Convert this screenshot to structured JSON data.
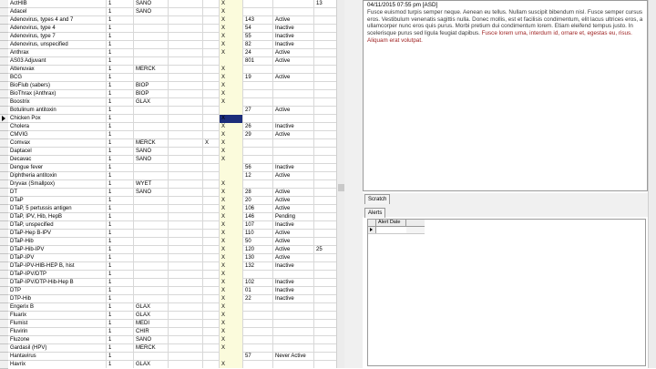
{
  "grid": {
    "rows": [
      {
        "name": "ActHIB",
        "num": "1",
        "a": "SANO",
        "b": "",
        "c": "",
        "x": "X",
        "d": "",
        "status": "",
        "e": "13"
      },
      {
        "name": "Adacel",
        "num": "1",
        "a": "SANO",
        "b": "",
        "c": "",
        "x": "X",
        "d": "",
        "status": "",
        "e": ""
      },
      {
        "name": "Adenovirus, types 4 and 7",
        "num": "1",
        "a": "",
        "b": "",
        "c": "",
        "x": "X",
        "d": "143",
        "status": "Active",
        "e": ""
      },
      {
        "name": "Adenovirus, type 4",
        "num": "1",
        "a": "",
        "b": "",
        "c": "",
        "x": "X",
        "d": "54",
        "status": "Inactive",
        "e": ""
      },
      {
        "name": "Adenovirus, type 7",
        "num": "1",
        "a": "",
        "b": "",
        "c": "",
        "x": "X",
        "d": "55",
        "status": "Inactive",
        "e": ""
      },
      {
        "name": "Adenovirus, unspecified",
        "num": "1",
        "a": "",
        "b": "",
        "c": "",
        "x": "X",
        "d": "82",
        "status": "Inactive",
        "e": ""
      },
      {
        "name": "Anthrax",
        "num": "1",
        "a": "",
        "b": "",
        "c": "",
        "x": "X",
        "d": "24",
        "status": "Active",
        "e": ""
      },
      {
        "name": "AS03 Adjuvant",
        "num": "1",
        "a": "",
        "b": "",
        "c": "",
        "x": "",
        "d": "801",
        "status": "Active",
        "e": ""
      },
      {
        "name": "Attenuvax",
        "num": "1",
        "a": "MERCK",
        "b": "",
        "c": "",
        "x": "X",
        "d": "",
        "status": "",
        "e": ""
      },
      {
        "name": "BCG",
        "num": "1",
        "a": "",
        "b": "",
        "c": "",
        "x": "X",
        "d": "19",
        "status": "Active",
        "e": ""
      },
      {
        "name": "BioFlub (sabers)",
        "num": "1",
        "a": "BIOP",
        "b": "",
        "c": "",
        "x": "X",
        "d": "",
        "status": "",
        "e": ""
      },
      {
        "name": "BioThrax (Anthrax)",
        "num": "1",
        "a": "BIOP",
        "b": "",
        "c": "",
        "x": "X",
        "d": "",
        "status": "",
        "e": ""
      },
      {
        "name": "Boostrix",
        "num": "1",
        "a": "GLAX",
        "b": "",
        "c": "",
        "x": "X",
        "d": "",
        "status": "",
        "e": ""
      },
      {
        "name": "Botulinum antitoxin",
        "num": "1",
        "a": "",
        "b": "",
        "c": "",
        "x": "",
        "d": "27",
        "status": "Active",
        "e": ""
      },
      {
        "name": "Chicken Pox",
        "num": "1",
        "a": "",
        "b": "",
        "c": "",
        "x": "X",
        "d": "",
        "status": "",
        "e": ""
      },
      {
        "name": "Cholera",
        "num": "1",
        "a": "",
        "b": "",
        "c": "",
        "x": "X",
        "d": "26",
        "status": "Inactive",
        "e": ""
      },
      {
        "name": "CMVIG",
        "num": "1",
        "a": "",
        "b": "",
        "c": "",
        "x": "X",
        "d": "29",
        "status": "Active",
        "e": ""
      },
      {
        "name": "Comvax",
        "num": "1",
        "a": "MERCK",
        "b": "",
        "c": "X",
        "x": "X",
        "d": "",
        "status": "",
        "e": ""
      },
      {
        "name": "Daptacel",
        "num": "1",
        "a": "SANO",
        "b": "",
        "c": "",
        "x": "X",
        "d": "",
        "status": "",
        "e": ""
      },
      {
        "name": "Decavac",
        "num": "1",
        "a": "SANO",
        "b": "",
        "c": "",
        "x": "X",
        "d": "",
        "status": "",
        "e": ""
      },
      {
        "name": "Dengue fever",
        "num": "1",
        "a": "",
        "b": "",
        "c": "",
        "x": "",
        "d": "56",
        "status": "Inactive",
        "e": ""
      },
      {
        "name": "Diphtheria antitoxin",
        "num": "1",
        "a": "",
        "b": "",
        "c": "",
        "x": "",
        "d": "12",
        "status": "Active",
        "e": ""
      },
      {
        "name": "Dryvax (Smallpox)",
        "num": "1",
        "a": "WYET",
        "b": "",
        "c": "",
        "x": "X",
        "d": "",
        "status": "",
        "e": ""
      },
      {
        "name": "DT",
        "num": "1",
        "a": "SANO",
        "b": "",
        "c": "",
        "x": "X",
        "d": "28",
        "status": "Active",
        "e": ""
      },
      {
        "name": "DTaP",
        "num": "1",
        "a": "",
        "b": "",
        "c": "",
        "x": "X",
        "d": "20",
        "status": "Active",
        "e": ""
      },
      {
        "name": "DTaP, 5 pertussis antigen",
        "num": "1",
        "a": "",
        "b": "",
        "c": "",
        "x": "X",
        "d": "106",
        "status": "Active",
        "e": ""
      },
      {
        "name": "DTaP, IPV, Hib, HepB",
        "num": "1",
        "a": "",
        "b": "",
        "c": "",
        "x": "X",
        "d": "146",
        "status": "Pending",
        "e": ""
      },
      {
        "name": "DTaP, unspecified",
        "num": "1",
        "a": "",
        "b": "",
        "c": "",
        "x": "X",
        "d": "107",
        "status": "Inactive",
        "e": ""
      },
      {
        "name": "DTaP-Hep B-IPV",
        "num": "1",
        "a": "",
        "b": "",
        "c": "",
        "x": "X",
        "d": "110",
        "status": "Active",
        "e": ""
      },
      {
        "name": "DTaP-Hib",
        "num": "1",
        "a": "",
        "b": "",
        "c": "",
        "x": "X",
        "d": "50",
        "status": "Active",
        "e": ""
      },
      {
        "name": "DTaP-Hib-IPV",
        "num": "1",
        "a": "",
        "b": "",
        "c": "",
        "x": "X",
        "d": "120",
        "status": "Active",
        "e": "25"
      },
      {
        "name": "DTaP-IPV",
        "num": "1",
        "a": "",
        "b": "",
        "c": "",
        "x": "X",
        "d": "130",
        "status": "Active",
        "e": ""
      },
      {
        "name": "DTaP-IPV-HIB-HEP B, hist",
        "num": "1",
        "a": "",
        "b": "",
        "c": "",
        "x": "X",
        "d": "132",
        "status": "Inactive",
        "e": ""
      },
      {
        "name": "DTaP-IPV/DTP",
        "num": "1",
        "a": "",
        "b": "",
        "c": "",
        "x": "X",
        "d": "",
        "status": "",
        "e": ""
      },
      {
        "name": "DTaP-IPV/DTP-Hib-Hep B",
        "num": "1",
        "a": "",
        "b": "",
        "c": "",
        "x": "X",
        "d": "102",
        "status": "Inactive",
        "e": ""
      },
      {
        "name": "DTP",
        "num": "1",
        "a": "",
        "b": "",
        "c": "",
        "x": "X",
        "d": "01",
        "status": "Inactive",
        "e": ""
      },
      {
        "name": "DTP-Hib",
        "num": "1",
        "a": "",
        "b": "",
        "c": "",
        "x": "X",
        "d": "22",
        "status": "Inactive",
        "e": ""
      },
      {
        "name": "Engerix B",
        "num": "1",
        "a": "GLAX",
        "b": "",
        "c": "",
        "x": "X",
        "d": "",
        "status": "",
        "e": ""
      },
      {
        "name": "Fluarix",
        "num": "1",
        "a": "GLAX",
        "b": "",
        "c": "",
        "x": "X",
        "d": "",
        "status": "",
        "e": ""
      },
      {
        "name": "Flumist",
        "num": "1",
        "a": "MEDI",
        "b": "",
        "c": "",
        "x": "X",
        "d": "",
        "status": "",
        "e": ""
      },
      {
        "name": "Fluvirin",
        "num": "1",
        "a": "CHIR",
        "b": "",
        "c": "",
        "x": "X",
        "d": "",
        "status": "",
        "e": ""
      },
      {
        "name": "Fluzone",
        "num": "1",
        "a": "SANO",
        "b": "",
        "c": "",
        "x": "X",
        "d": "",
        "status": "",
        "e": ""
      },
      {
        "name": "Gardasil (HPV)",
        "num": "1",
        "a": "MERCK",
        "b": "",
        "c": "",
        "x": "X",
        "d": "",
        "status": "",
        "e": ""
      },
      {
        "name": "Hantavirus",
        "num": "1",
        "a": "",
        "b": "",
        "c": "",
        "x": "",
        "d": "57",
        "status": "Never Active",
        "e": ""
      },
      {
        "name": "Havrix",
        "num": "1",
        "a": "GLAX",
        "b": "",
        "c": "",
        "x": "X",
        "d": "",
        "status": "",
        "e": ""
      }
    ]
  },
  "notes": {
    "header": "04/11/2015 07:55 pm [ASD]",
    "body": "Fusce euismod turpis semper neque. Aenean eu tellus. Nullam suscipit bibendum nisl. Fusce semper cursus eros. Vestibulum venenatis sagittis nulla. Donec mollis, est et facilisis condimentum, elit lacus ultrices eros, a ullamcorper nunc eros quis purus. Morbi pretium dui condimentum lorem. Etiam eleifend tempus justo. In scelerisque purus sed ligula feugiat dapibus.",
    "body_red": "Fusce lorem urna, interdum id, ornare et, egestas eu, risus. Aliquam erat volutpat."
  },
  "tabs": {
    "scratch": "Scratch",
    "alerts": "Alerts"
  },
  "alerts_grid": {
    "col_alert_date": "Alert Date"
  },
  "colors": {
    "selected_cell": "#1c2d7a",
    "x_column_bg": "#fbfbdc",
    "note_red": "#9c1d1d"
  }
}
